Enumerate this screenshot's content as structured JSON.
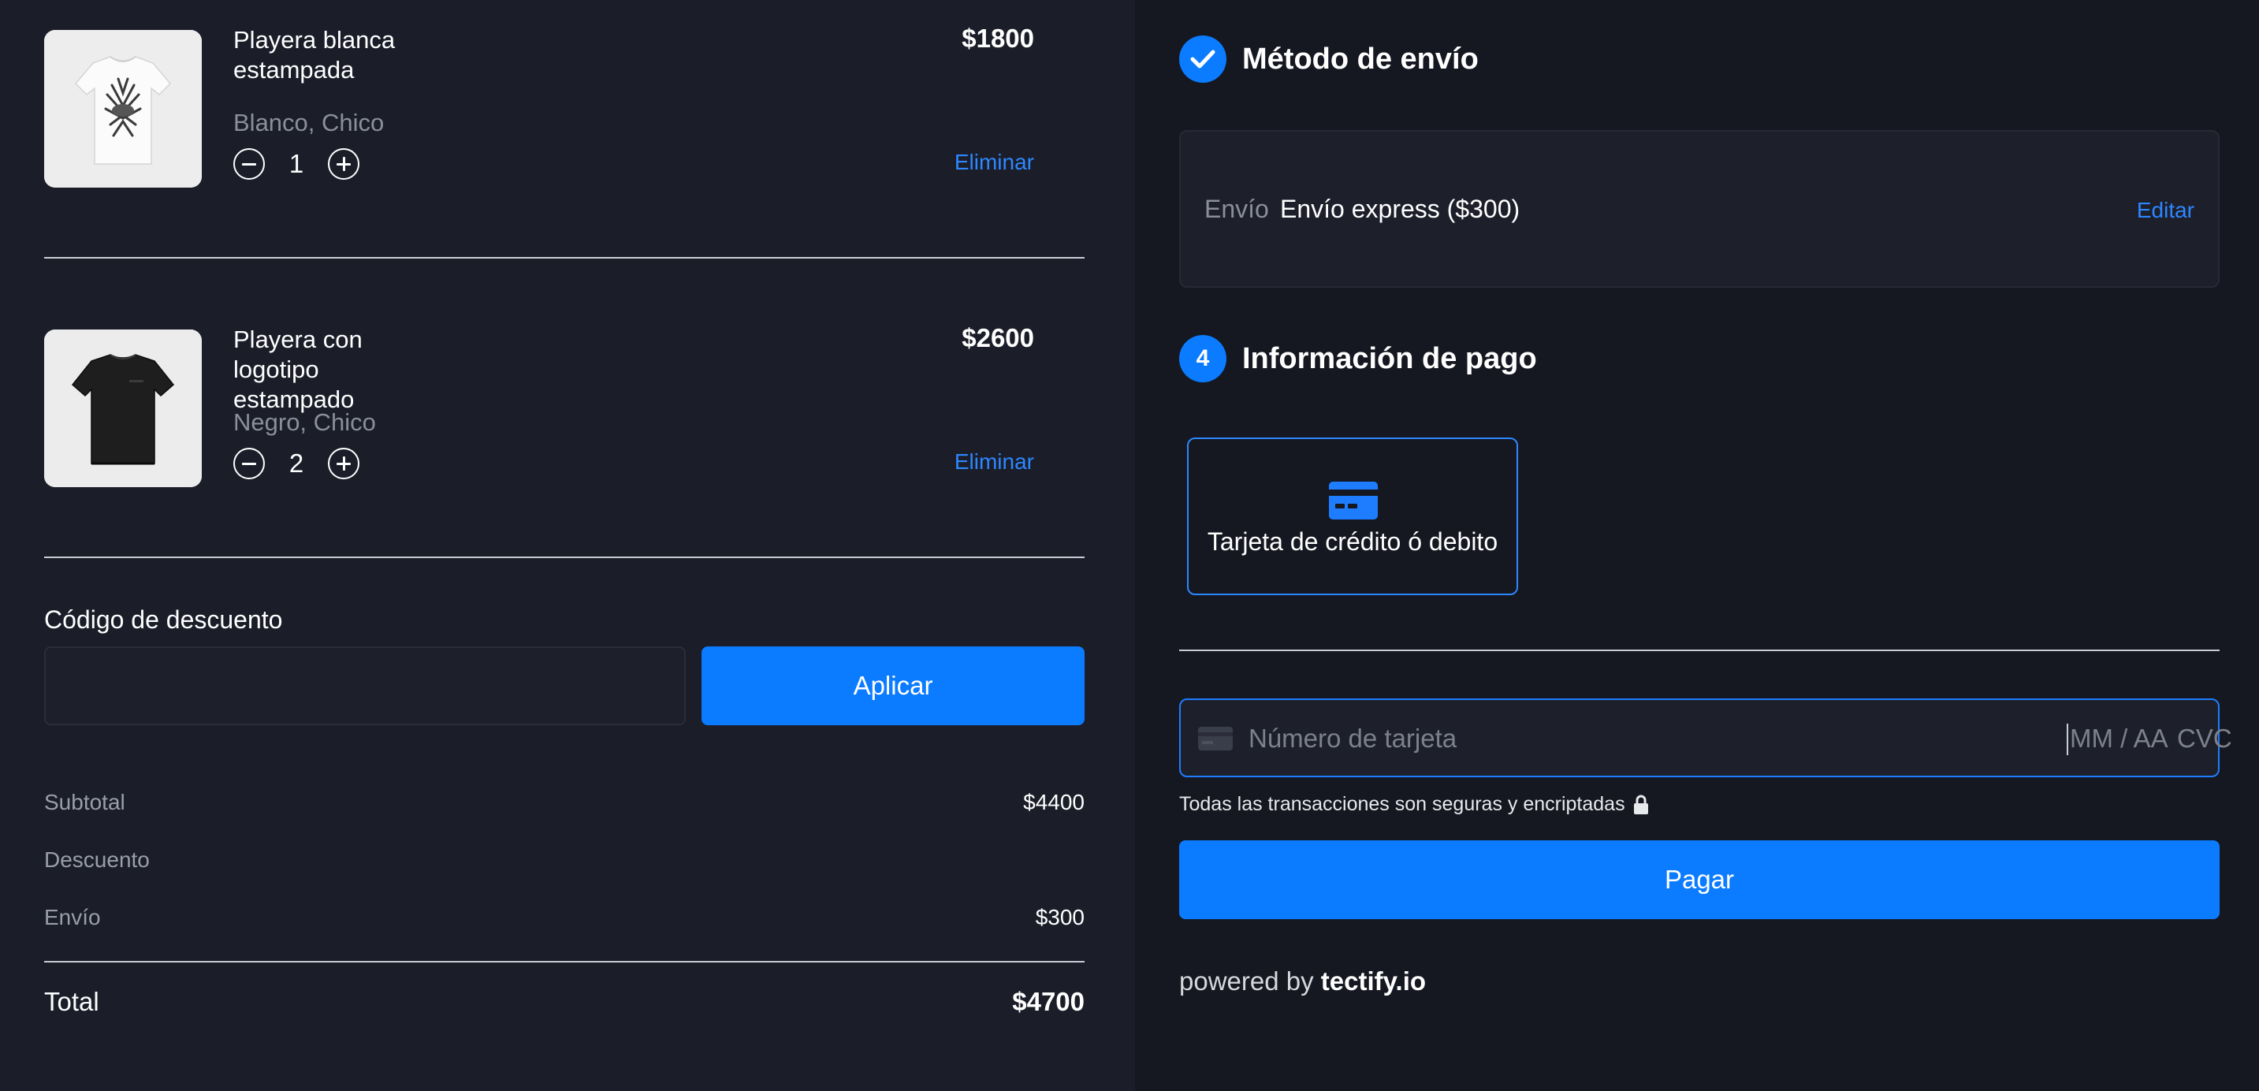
{
  "cart": {
    "items": [
      {
        "name": "Playera blanca estampada",
        "variant": "Blanco, Chico",
        "quantity": "1",
        "price": "$1800",
        "remove_label": "Eliminar",
        "image": "white-tshirt-print"
      },
      {
        "name": "Playera con logotipo estampado",
        "variant": "Negro, Chico",
        "quantity": "2",
        "price": "$2600",
        "remove_label": "Eliminar",
        "image": "black-tshirt-logo"
      }
    ]
  },
  "discount": {
    "label": "Código de descuento",
    "input_value": "",
    "apply_label": "Aplicar"
  },
  "summary": {
    "subtotal_label": "Subtotal",
    "subtotal_value": "$4400",
    "discount_label": "Descuento",
    "discount_value": "",
    "shipping_label": "Envío",
    "shipping_value": "$300",
    "total_label": "Total",
    "total_value": "$4700"
  },
  "shipping_step": {
    "icon": "check-icon",
    "title": "Método de envío",
    "label": "Envío",
    "value": "Envío express ($300)",
    "edit_label": "Editar"
  },
  "payment_step": {
    "number": "4",
    "title": "Información de pago",
    "method_label": "Tarjeta de crédito ó debito",
    "method_icon": "credit-card-icon",
    "card_number_placeholder": "Número de tarjeta",
    "expiry_placeholder": "MM / AA",
    "cvc_placeholder": "CVC",
    "secure_note": "Todas las transacciones son seguras y encriptadas",
    "pay_label": "Pagar",
    "powered_prefix": "powered by",
    "powered_brand": "tectify.io"
  },
  "colors": {
    "accent": "#0b7bff",
    "link": "#2d87ff",
    "left_bg": "#1b1e29",
    "right_bg": "#161821"
  }
}
